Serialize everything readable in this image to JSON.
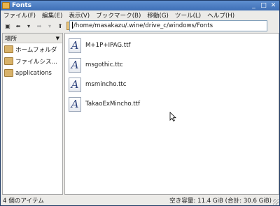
{
  "window": {
    "title": "Fonts"
  },
  "menubar": {
    "items": [
      "ファイル(F)",
      "編集(E)",
      "表示(V)",
      "ブックマーク(B)",
      "移動(G)",
      "ツール(L)",
      "ヘルプ(H)"
    ]
  },
  "toolbar": {
    "path": "/home/masakazu/.wine/drive_c/windows/Fonts"
  },
  "sidebar": {
    "header": "場所",
    "items": [
      {
        "label": "ホームフォルダ"
      },
      {
        "label": "ファイルシス..."
      },
      {
        "label": "applications"
      }
    ]
  },
  "files": [
    {
      "name": "M+1P+IPAG.ttf",
      "icon": "font-file-icon",
      "glyph": "A"
    },
    {
      "name": "msgothic.ttc",
      "icon": "font-file-icon",
      "glyph": "A"
    },
    {
      "name": "msmincho.ttc",
      "icon": "font-file-icon",
      "glyph": "A"
    },
    {
      "name": "TakaoExMincho.ttf",
      "icon": "font-file-icon",
      "glyph": "A"
    }
  ],
  "status": {
    "item_count": "4 個のアイテム",
    "free_space": "空き容量: 11.4 GiB (合計: 30.6 GiB)"
  }
}
